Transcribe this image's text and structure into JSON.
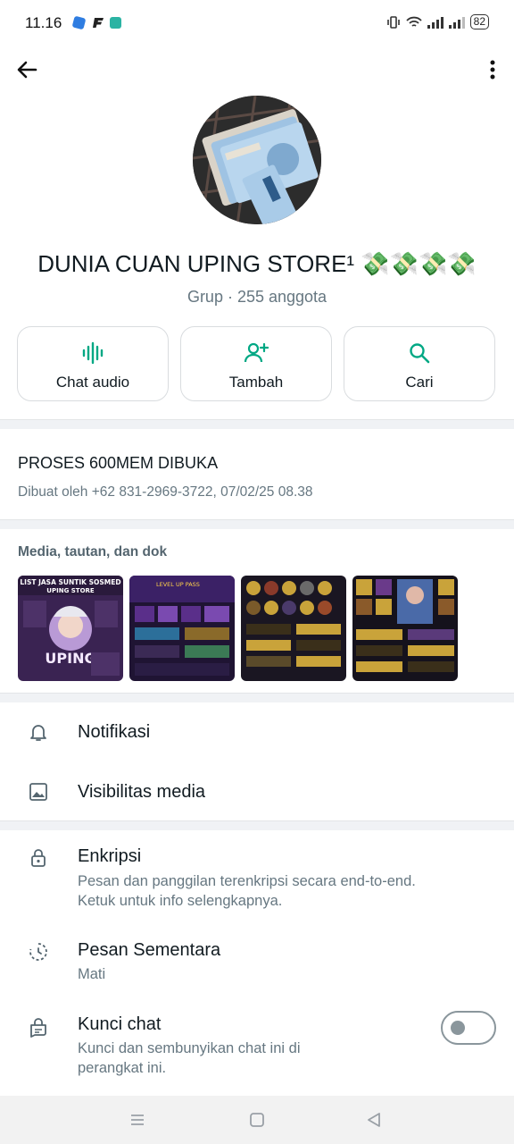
{
  "status_bar": {
    "time": "11.16",
    "battery": "82"
  },
  "group": {
    "name": "DUNIA CUAN UPING STORE¹ 💸💸💸💸",
    "subtitle": "Grup · 255 anggota"
  },
  "actions": [
    {
      "label": "Chat audio",
      "icon": "audio-wave-icon"
    },
    {
      "label": "Tambah",
      "icon": "add-person-icon"
    },
    {
      "label": "Cari",
      "icon": "search-icon"
    }
  ],
  "description": {
    "text": "PROSES 600MEM DIBUKA",
    "created_by": "Dibuat oleh +62 831-2969-3722, 07/02/25 08.38"
  },
  "media": {
    "title": "Media, tautan, dan dok",
    "thumb1_lines": [
      "LIST JASA SUNTIK SOSMED",
      "UPING STORE",
      "UPING"
    ],
    "thumb2_line": "LEVEL UP PASS"
  },
  "settings": {
    "notifications": "Notifikasi",
    "media_visibility": "Visibilitas media",
    "encryption": {
      "title": "Enkripsi",
      "line1": "Pesan dan panggilan terenkripsi secara end-to-end.",
      "line2": "Ketuk untuk info selengkapnya."
    },
    "disappearing": {
      "title": "Pesan Sementara",
      "value": "Mati"
    },
    "chat_lock": {
      "title": "Kunci chat",
      "line1": "Kunci dan sembunyikan chat ini di",
      "line2": "perangkat ini.",
      "enabled": false
    }
  },
  "colors": {
    "accent": "#00a884",
    "secondary_text": "#667781"
  }
}
